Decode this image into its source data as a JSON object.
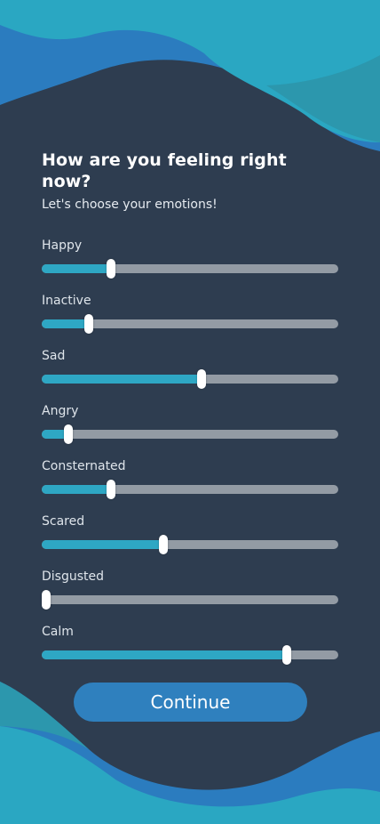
{
  "header": {
    "title": "How are you feeling right now?",
    "subtitle": "Let's choose your emotions!"
  },
  "emotions": [
    {
      "label": "Happy",
      "level": 0.235
    },
    {
      "label": "Inactive",
      "level": 0.16
    },
    {
      "label": "Sad",
      "level": 0.54
    },
    {
      "label": "Angry",
      "level": 0.09
    },
    {
      "label": "Consternated",
      "level": 0.235
    },
    {
      "label": "Scared",
      "level": 0.41
    },
    {
      "label": "Disgusted",
      "level": 0.015
    },
    {
      "label": "Calm",
      "level": 0.825
    }
  ],
  "actions": {
    "continue_label": "Continue"
  },
  "colors": {
    "background": "#2e3d50",
    "accent": "#2ea7c4",
    "track": "#939ba4",
    "button": "#2f80be",
    "thumb": "#ffffff"
  }
}
